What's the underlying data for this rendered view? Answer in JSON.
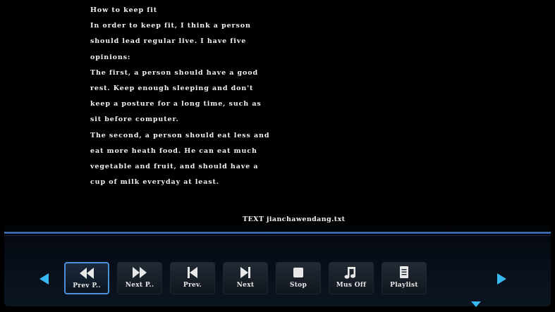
{
  "document": {
    "lines": [
      "How to keep fit",
      "In order to keep fit, I think a person",
      "should lead regular live. I have five",
      "opinions:",
      "The first, a person should have a good",
      "rest. Keep enough sleeping and don't",
      "keep a posture for a long time, such as",
      "sit before computer.",
      "The second, a person should eat less and",
      "eat more heath food. He can eat much",
      "vegetable and fruit, and should have a",
      "cup of milk everyday at least."
    ],
    "file_label": "TEXT jianchawendang.txt"
  },
  "toolbar": {
    "buttons": [
      {
        "label": "Prev P..",
        "icon": "rewind-icon"
      },
      {
        "label": "Next P..",
        "icon": "fast-forward-icon"
      },
      {
        "label": "Prev.",
        "icon": "skip-previous-icon"
      },
      {
        "label": "Next",
        "icon": "skip-next-icon"
      },
      {
        "label": "Stop",
        "icon": "stop-icon"
      },
      {
        "label": "Mus Off",
        "icon": "music-note-icon"
      },
      {
        "label": "Playlist",
        "icon": "playlist-icon"
      }
    ],
    "selected_index": 0
  },
  "colors": {
    "background": "#000000",
    "accent": "#4a90d8",
    "arrow": "#38b8f0",
    "text": "#f2f2f2"
  }
}
